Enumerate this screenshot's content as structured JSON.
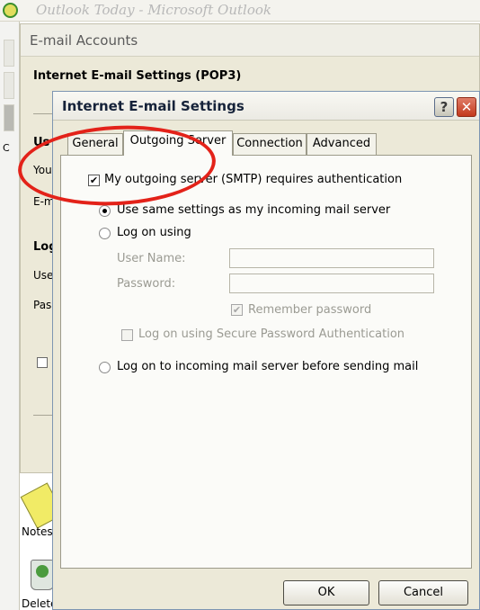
{
  "outlook": {
    "title": "Outlook Today - Microsoft Outlook",
    "shortcuts": {
      "notes": "Notes",
      "deleted": "Deleted"
    }
  },
  "email_accounts": {
    "title": "E-mail Accounts",
    "subtitle": "Internet E-mail Settings (POP3)",
    "fragments": {
      "c": "C",
      "u": "Us",
      "you": "You",
      "em": "E-m",
      "log": "Log",
      "use": "Use",
      "pas": "Pas"
    }
  },
  "dialog": {
    "title": "Internet E-mail Settings",
    "help_label": "?",
    "close_label": "✕",
    "tabs": [
      {
        "label": "General",
        "active": false
      },
      {
        "label": "Outgoing Server",
        "active": true
      },
      {
        "label": "Connection",
        "active": false
      },
      {
        "label": "Advanced",
        "active": false
      }
    ],
    "requires_auth": {
      "label": "My outgoing server (SMTP) requires authentication",
      "checked": true
    },
    "option_same": {
      "label": "Use same settings as my incoming mail server",
      "selected": true
    },
    "option_logon": {
      "label": "Log on using",
      "selected": false
    },
    "user_name": {
      "label": "User Name:",
      "value": ""
    },
    "password": {
      "label": "Password:",
      "value": ""
    },
    "remember_password": {
      "label": "Remember password",
      "checked": true,
      "disabled": true
    },
    "spa": {
      "label": "Log on using Secure Password Authentication",
      "checked": false,
      "disabled": true
    },
    "option_before": {
      "label": "Log on to incoming mail server before sending mail",
      "selected": false
    },
    "ok_label": "OK",
    "cancel_label": "Cancel"
  },
  "annotation": {
    "color": "#e32219"
  }
}
